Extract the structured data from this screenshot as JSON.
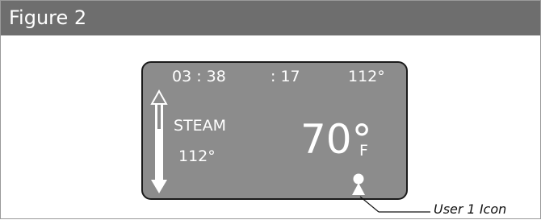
{
  "figure": {
    "title": "Figure 2"
  },
  "display": {
    "time": "03 : 38",
    "seconds": ": 17",
    "top_temp": "112°",
    "mode": "STEAM",
    "mode_temp": "112°",
    "current_temp": "70°",
    "unit": "F",
    "icons": {
      "scroll": "up-down-arrow-icon",
      "user": "user-1-icon"
    }
  },
  "callout": {
    "label": "User 1 Icon"
  },
  "colors": {
    "header_bg": "#6e6e6e",
    "screen_bg": "#8c8c8c",
    "text": "#ffffff"
  }
}
